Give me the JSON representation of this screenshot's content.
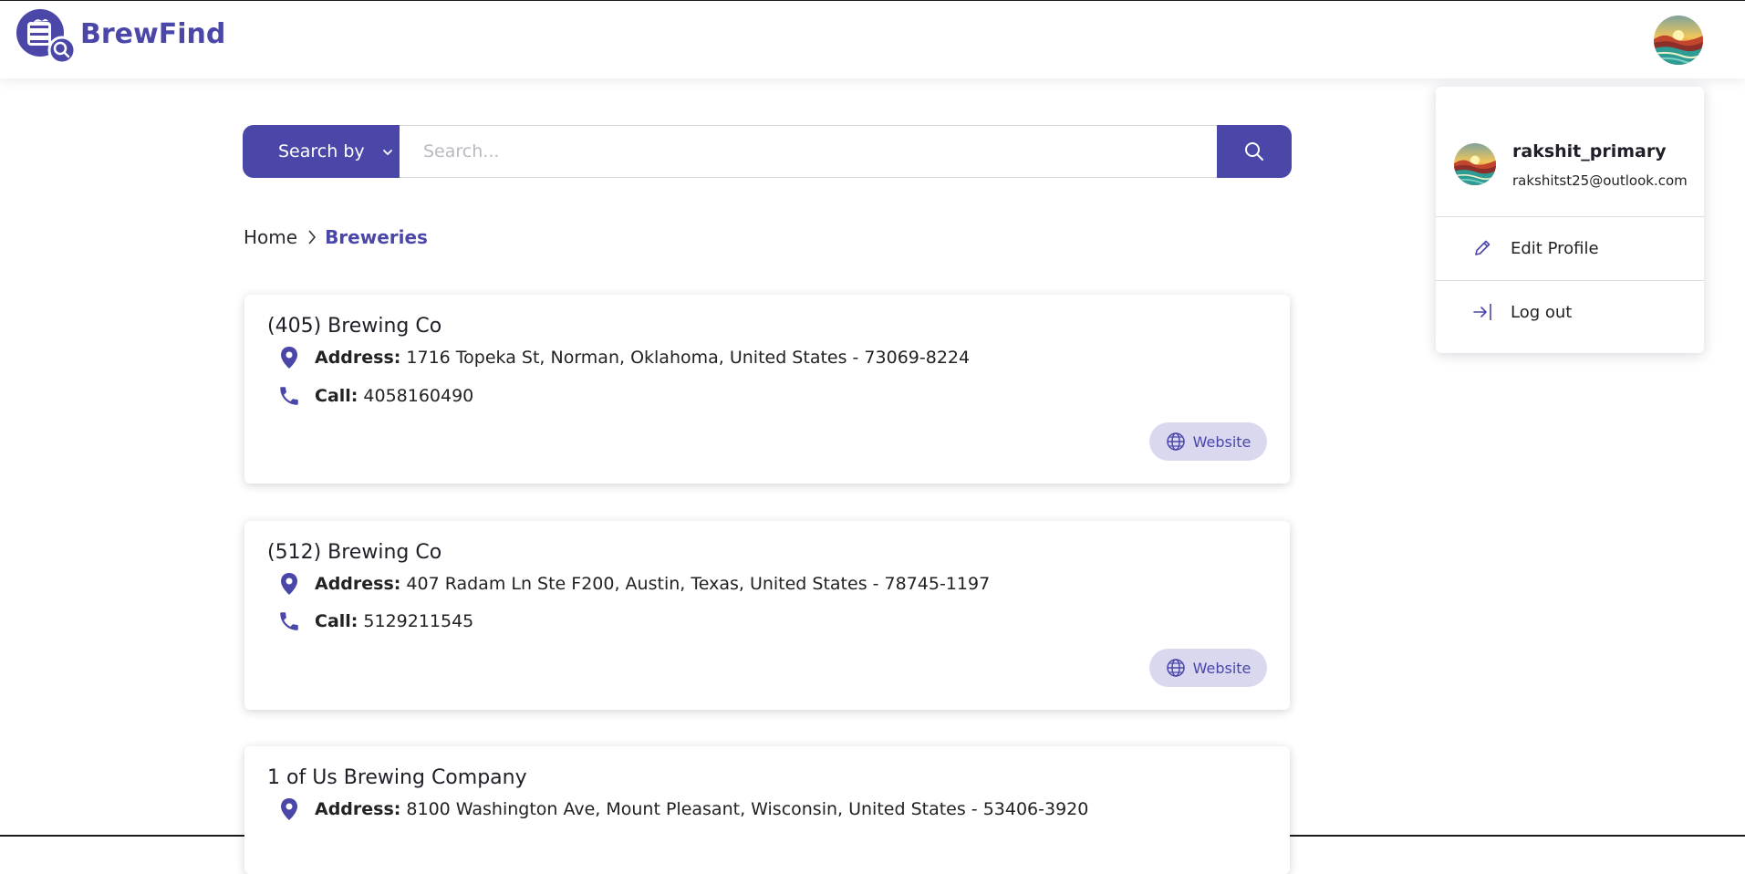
{
  "brand": {
    "name": "BrewFind",
    "accent_color": "#4a47a9"
  },
  "header": {
    "avatar_icon": "user-avatar"
  },
  "search": {
    "dropdown_label": "Search by",
    "placeholder": "Search...",
    "button_icon": "search-icon"
  },
  "breadcrumb": {
    "home": "Home",
    "current": "Breweries"
  },
  "breweries": [
    {
      "name": "(405) Brewing Co",
      "address_label": "Address:",
      "address": "1716 Topeka St, Norman, Oklahoma, United States - 73069-8224",
      "call_label": "Call:",
      "phone": "4058160490",
      "website_label": "Website"
    },
    {
      "name": "(512) Brewing Co",
      "address_label": "Address:",
      "address": "407 Radam Ln Ste F200, Austin, Texas, United States - 78745-1197",
      "call_label": "Call:",
      "phone": "5129211545",
      "website_label": "Website"
    },
    {
      "name": "1 of Us Brewing Company",
      "address_label": "Address:",
      "address": "8100 Washington Ave, Mount Pleasant, Wisconsin, United States - 53406-3920"
    }
  ],
  "user_menu": {
    "username": "rakshit_primary",
    "email": "rakshitst25@outlook.com",
    "edit_profile": "Edit Profile",
    "log_out": "Log out"
  }
}
